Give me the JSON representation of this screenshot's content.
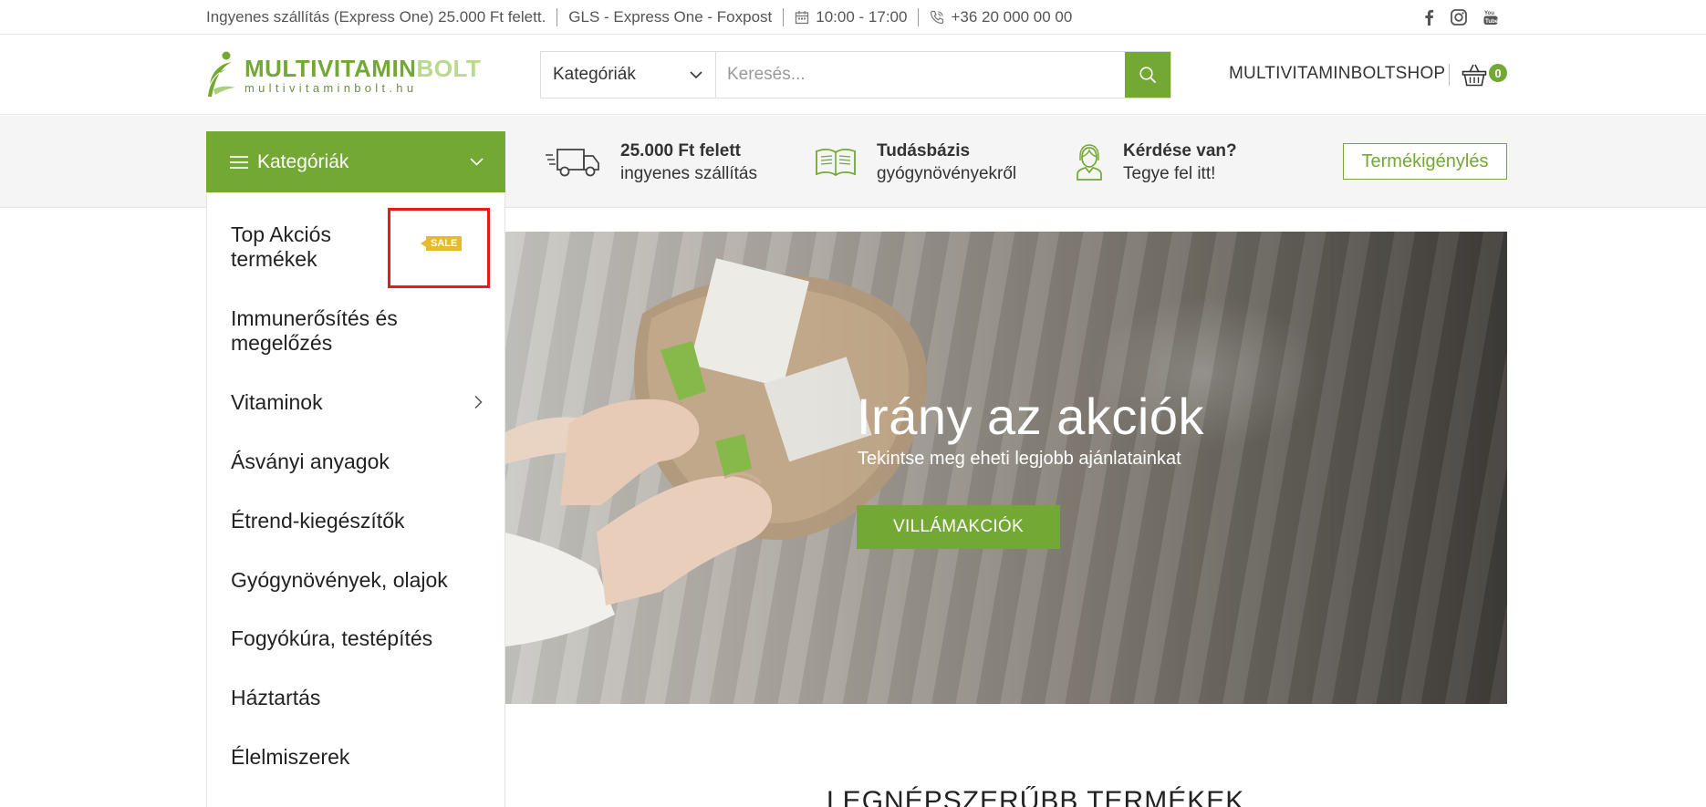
{
  "topbar": {
    "shipping_note": "Ingyenes szállítás (Express One) 25.000 Ft felett.",
    "carriers": "GLS - Express One - Foxpost",
    "hours": "10:00 - 17:00",
    "phone": "+36 20 000 00 00",
    "social_icons": [
      "facebook-icon",
      "instagram-icon",
      "youtube-icon"
    ]
  },
  "header": {
    "logo_main": "MULTIVITAMIN",
    "logo_main_accent": "BOLT",
    "logo_sub": "multivitaminbolt.hu",
    "search_category": "Kategóriák",
    "search_placeholder": "Keresés...",
    "shop_link": "MULTIVITAMINBOLTSHOP",
    "cart_count": "0"
  },
  "featbar": {
    "categories_label": "Kategóriák",
    "features": [
      {
        "title": "25.000 Ft felett",
        "subtitle": "ingyenes szállítás",
        "icon": "truck-icon"
      },
      {
        "title": "Tudásbázis",
        "subtitle": "gyógynövényekről",
        "icon": "book-icon"
      },
      {
        "title": "Kérdése van?",
        "subtitle": "Tegye fel itt!",
        "icon": "support-agent-icon"
      }
    ],
    "request_button": "Termékigénylés"
  },
  "categories": {
    "items": [
      "Top Akciós\ntermékek",
      "Immunerősítés és\nmegelőzés",
      "Vitaminok",
      "Ásványi anyagok",
      "Étrend-kiegészítők",
      "Gyógynövények, olajok",
      "Fogyókúra, testépítés",
      "Háztartás",
      "Élelmiszerek"
    ],
    "sale_badge": "SALE"
  },
  "hero": {
    "title": "Irány az akciók",
    "subtitle": "Tekintse meg eheti legjobb ajánlatainkat",
    "button": "VILLÁMAKCIÓK"
  },
  "section": {
    "title": "LEGNÉPSZERŰBB TERMÉKEK"
  },
  "colors": {
    "brand": "#72a833",
    "sale": "#e8b928",
    "highlight": "#e41c1c"
  }
}
